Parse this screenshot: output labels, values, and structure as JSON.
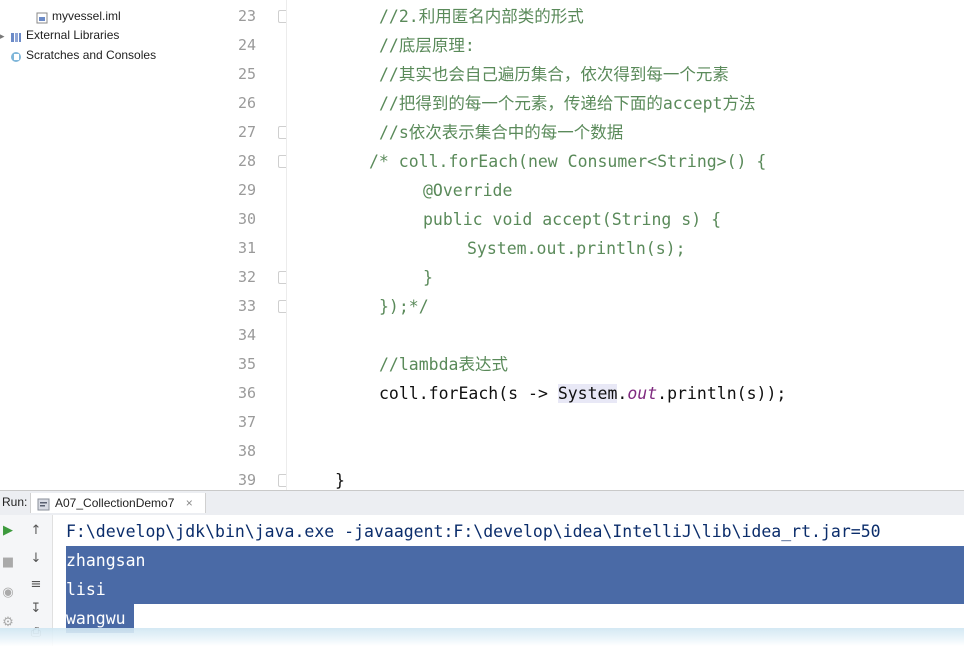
{
  "project_tree": [
    {
      "label": "myvessel.iml",
      "icon": "module-file-icon"
    },
    {
      "label": "External Libraries",
      "icon": "library-icon"
    },
    {
      "label": "Scratches and Consoles",
      "icon": "scratches-icon"
    }
  ],
  "editor": {
    "lines": [
      {
        "number": "23",
        "text": "//2.利用匿名内部类的形式"
      },
      {
        "number": "24",
        "text": "//底层原理:"
      },
      {
        "number": "25",
        "text": "//其实也会自己遍历集合，依次得到每一个元素"
      },
      {
        "number": "26",
        "text": "//把得到的每一个元素，传递给下面的accept方法"
      },
      {
        "number": "27",
        "text": "//s依次表示集合中的每一个数据"
      },
      {
        "number": "28",
        "text": "/* coll.forEach(new Consumer<String>() {"
      },
      {
        "number": "29",
        "text": "@Override"
      },
      {
        "number": "30",
        "text": "public void accept(String s) {"
      },
      {
        "number": "31",
        "text": "System.out.println(s);"
      },
      {
        "number": "32",
        "text": "}"
      },
      {
        "number": "33",
        "text": "});*/"
      },
      {
        "number": "34",
        "text": ""
      },
      {
        "number": "35",
        "text": "//lambda表达式"
      },
      {
        "number": "36",
        "text": "coll.forEach(s -> System.out.println(s));"
      },
      {
        "number": "37",
        "text": ""
      },
      {
        "number": "38",
        "text": ""
      },
      {
        "number": "39",
        "text": "}"
      }
    ],
    "line36_parts": {
      "a": "coll.forEach(s -> ",
      "b": "System",
      "c": ".",
      "d": "out",
      "e": ".println(s));"
    }
  },
  "run": {
    "label": "Run:",
    "tab": "A07_CollectionDemo7",
    "command": "F:\\develop\\jdk\\bin\\java.exe -javaagent:F:\\develop\\idea\\IntelliJ\\lib\\idea_rt.jar=50",
    "output": [
      "zhangsan",
      "lisi",
      "wangwu"
    ]
  },
  "colors": {
    "selection": "#4a6aa6",
    "comment": "#5a8a5a",
    "keyword": "#000080",
    "annotation": "#6d6d00"
  }
}
